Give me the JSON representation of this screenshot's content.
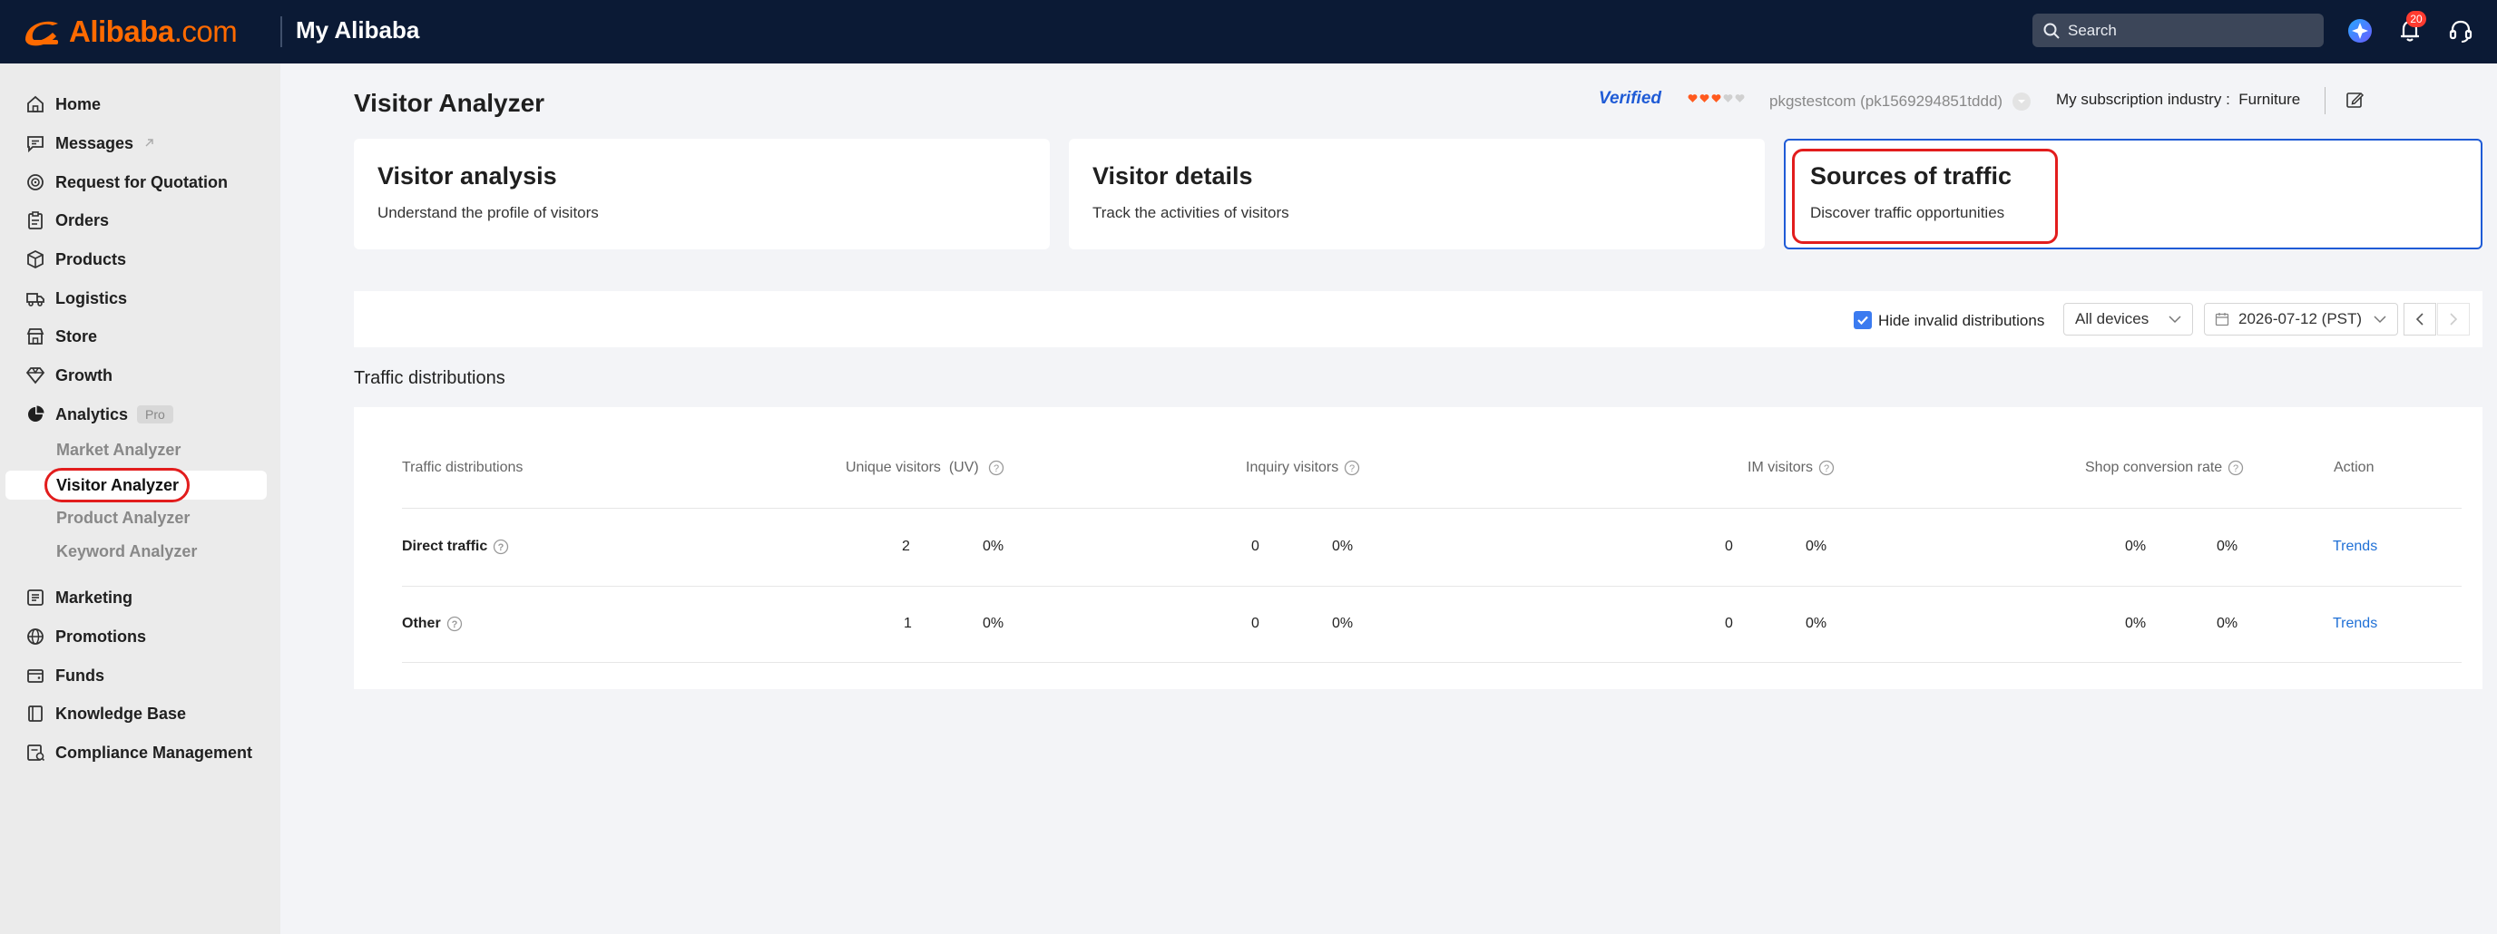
{
  "brand": {
    "name": "Alibaba",
    "suffix": ".com",
    "section": "My Alibaba",
    "color": "#ff6a00"
  },
  "header": {
    "search_placeholder": "Search",
    "notification_count": "20",
    "icons": [
      "search-icon",
      "ai-assistant-icon",
      "bell-icon",
      "headset-icon"
    ]
  },
  "sidebar": {
    "items": [
      {
        "label": "Home",
        "icon": "home-icon"
      },
      {
        "label": "Messages",
        "icon": "message-icon"
      },
      {
        "label": "Request for Quotation",
        "icon": "target-icon"
      },
      {
        "label": "Orders",
        "icon": "clipboard-icon"
      },
      {
        "label": "Products",
        "icon": "box-icon"
      },
      {
        "label": "Logistics",
        "icon": "truck-icon"
      },
      {
        "label": "Store",
        "icon": "store-icon"
      },
      {
        "label": "Growth",
        "icon": "diamond-icon"
      },
      {
        "label": "Analytics",
        "icon": "pie-chart-icon",
        "badge": "Pro"
      },
      {
        "label": "Marketing",
        "icon": "marketing-icon"
      },
      {
        "label": "Promotions",
        "icon": "globe-icon"
      },
      {
        "label": "Funds",
        "icon": "wallet-icon"
      },
      {
        "label": "Knowledge Base",
        "icon": "book-icon"
      },
      {
        "label": "Compliance Management",
        "icon": "compliance-icon"
      }
    ],
    "analytics_sub": [
      {
        "label": "Market Analyzer"
      },
      {
        "label": "Visitor Analyzer",
        "active": true
      },
      {
        "label": "Product Analyzer"
      },
      {
        "label": "Keyword Analyzer"
      }
    ]
  },
  "main": {
    "title": "Visitor Analyzer",
    "verified": "Verified",
    "account": "pkgstestcom (pk1569294851tddd)",
    "industry": "My subscription industry :  Furniture",
    "cards": [
      {
        "title": "Visitor analysis",
        "subtitle": "Understand the profile of visitors"
      },
      {
        "title": "Visitor details",
        "subtitle": "Track the activities of visitors"
      },
      {
        "title": "Sources of traffic",
        "subtitle": "Discover traffic opportunities",
        "active": true
      }
    ],
    "filters": {
      "hide_invalid_label": "Hide invalid distributions",
      "hide_invalid_checked": true,
      "device": "All devices",
      "date": "2026-07-12 (PST)"
    },
    "section_title": "Traffic distributions",
    "table": {
      "headers": [
        "Traffic distributions",
        "Unique visitors  (UV)",
        "Inquiry visitors",
        "IM visitors",
        "Shop conversion rate",
        "Action"
      ],
      "rows": [
        {
          "name": "Direct traffic",
          "uv": "2",
          "uv_pct": "0%",
          "inquiry": "0",
          "inquiry_pct": "0%",
          "im": "0",
          "im_pct": "0%",
          "conv": "0%",
          "conv_pct": "0%",
          "action": "Trends"
        },
        {
          "name": "Other",
          "uv": "1",
          "uv_pct": "0%",
          "inquiry": "0",
          "inquiry_pct": "0%",
          "im": "0",
          "im_pct": "0%",
          "conv": "0%",
          "conv_pct": "0%",
          "action": "Trends"
        }
      ]
    }
  },
  "colors": {
    "topbar": "#0b1a35",
    "accent_blue": "#1f5bd6",
    "highlight_red": "#e21d1d",
    "link": "#1f70d6"
  }
}
